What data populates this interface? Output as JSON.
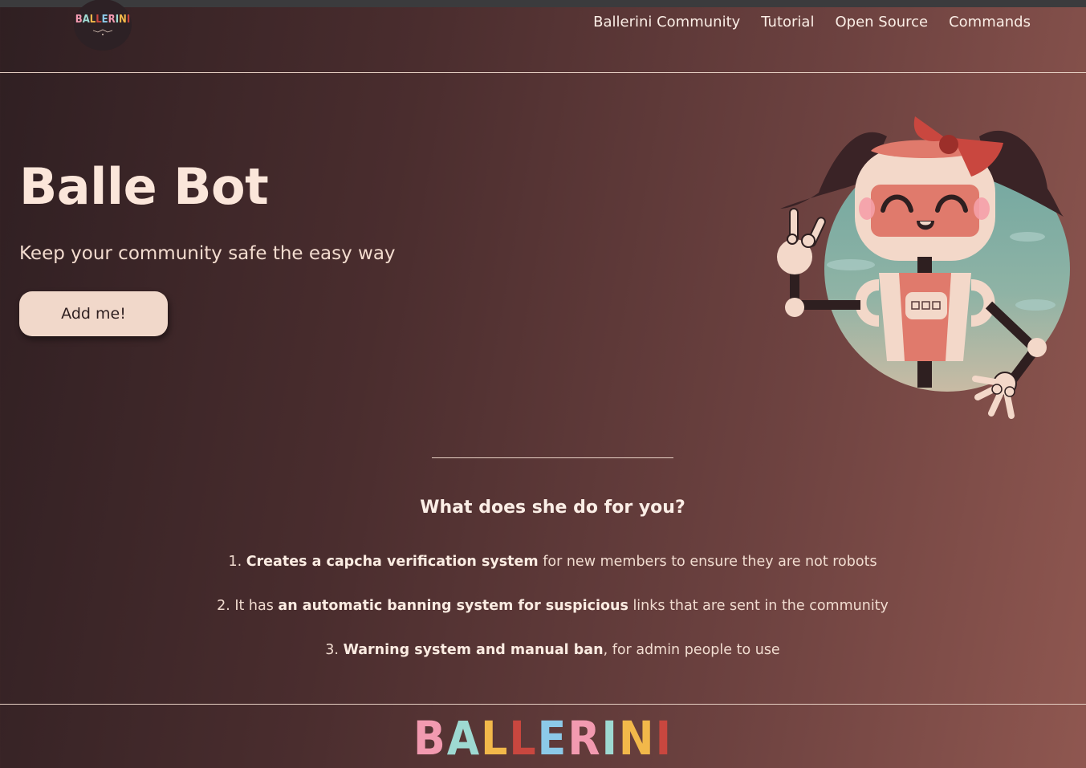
{
  "nav": {
    "logo_text": "BALLERINI",
    "links": [
      "Ballerini Community",
      "Tutorial",
      "Open Source",
      "Commands"
    ]
  },
  "hero": {
    "title": "Balle Bot",
    "subtitle": "Keep your community safe the easy way",
    "button_label": "Add me!"
  },
  "features": {
    "title": "What does she do for you?",
    "items": [
      {
        "prefix": "1. ",
        "bold": "Creates a capcha verification system",
        "rest": " for new members to ensure they are not robots"
      },
      {
        "prefix": "2. It has ",
        "bold": "an automatic banning system for suspicious",
        "rest": " links that are sent in the community"
      },
      {
        "prefix": "3. ",
        "bold": "Warning system and manual ban",
        "rest": ", for admin people to use"
      }
    ]
  },
  "footer": {
    "logo_letters": [
      "B",
      "A",
      "L",
      "L",
      "E",
      "R",
      "I",
      "N",
      "I"
    ],
    "logo_colors": [
      "#f29ab0",
      "#9ed9d2",
      "#f2b84a",
      "#c9473f",
      "#8cc9e8",
      "#f29ab0",
      "#9ed9d2",
      "#f2b84a",
      "#c9473f"
    ]
  },
  "colors": {
    "accent": "#f1d8ca",
    "robot_pink": "#e07a6c",
    "robot_cream": "#f3d8c9",
    "robot_dark": "#3a2326"
  }
}
